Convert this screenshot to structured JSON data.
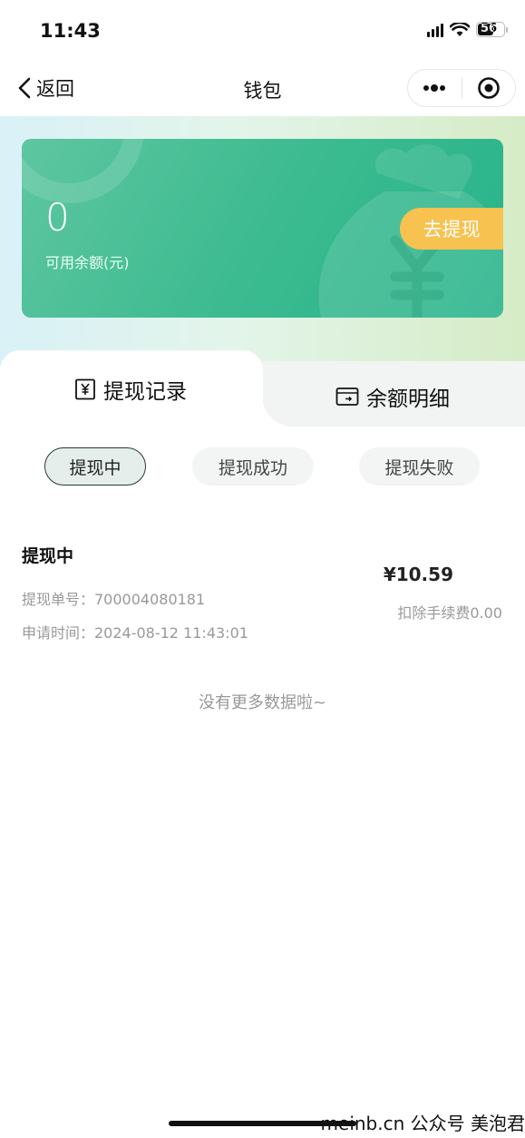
{
  "status_bar": {
    "time": "11:43",
    "battery": "56"
  },
  "nav": {
    "back_label": "返回",
    "title": "钱包"
  },
  "balance_card": {
    "amount": "0",
    "label": "可用余额(元)",
    "withdraw_label": "去提现"
  },
  "tabs": [
    {
      "label": "提现记录",
      "icon": "yen-receipt-icon",
      "active": true
    },
    {
      "label": "余额明细",
      "icon": "wallet-icon",
      "active": false
    }
  ],
  "filters": [
    {
      "label": "提现中",
      "active": true
    },
    {
      "label": "提现成功",
      "active": false
    },
    {
      "label": "提现失败",
      "active": false
    }
  ],
  "records": [
    {
      "status": "提现中",
      "order_no": "提现单号：700004080181",
      "apply_time": "申请时间：2024-08-12 11:43:01",
      "amount": "¥10.59",
      "fee": "扣除手续费0.00"
    }
  ],
  "list_end_text": "没有更多数据啦~",
  "watermark": "meinb.cn  公众号 美泡君",
  "colors": {
    "card_green": "#3dbb90",
    "withdraw_yellow": "#f7c24f",
    "chip_active_border": "#2a3a33"
  }
}
